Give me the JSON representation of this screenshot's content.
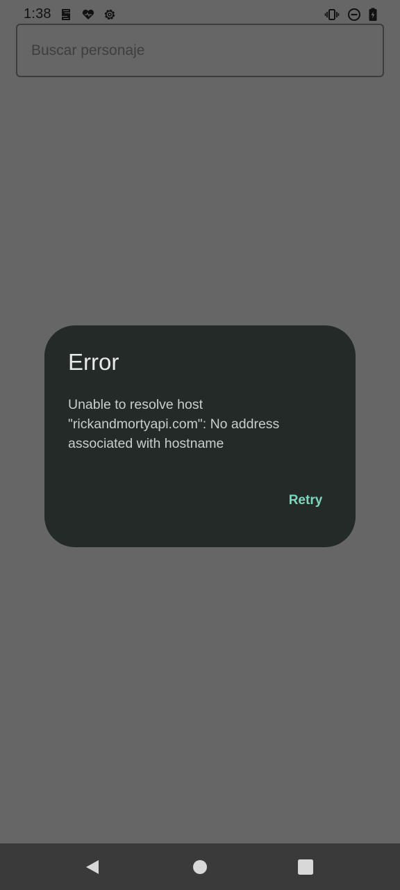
{
  "status_bar": {
    "time": "1:38",
    "icons": [
      "sync-icon",
      "heart-icon",
      "gear-icon",
      "vibrate-icon",
      "do-not-disturb-icon",
      "battery-icon"
    ]
  },
  "search": {
    "placeholder": "Buscar personaje",
    "value": ""
  },
  "dialog": {
    "title": "Error",
    "message": "Unable to resolve host \"rickandmortyapi.com\": No address associated with hostname",
    "retry_label": "Retry"
  },
  "nav_bar": {
    "icons": [
      "back-icon",
      "home-icon",
      "recents-icon"
    ]
  },
  "colors": {
    "scrim": "#666666",
    "dialog_surface": "#232a28",
    "accent": "#7fd6bd",
    "nav_bar": "#3a3a3a"
  }
}
